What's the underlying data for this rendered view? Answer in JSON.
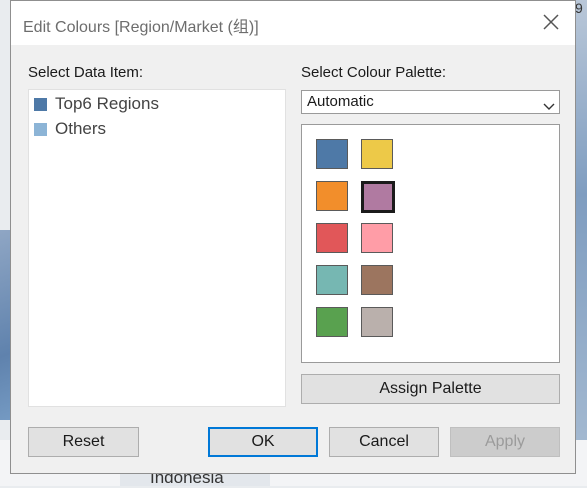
{
  "background": {
    "map_label": "Indonesia",
    "corner_digit": "9"
  },
  "dialog": {
    "title": "Edit Colours [Region/Market (组)]",
    "close_icon": "close-icon"
  },
  "data_items": {
    "label": "Select Data Item:",
    "items": [
      {
        "label": "Top6 Regions",
        "color": "#4e79a7"
      },
      {
        "label": "Others",
        "color": "#8cb4d6"
      }
    ]
  },
  "palette": {
    "label": "Select Colour Palette:",
    "selected": "Automatic",
    "selected_color": "#b07aa1",
    "colors": [
      "#4e79a7",
      "#edc948",
      "#f28e2b",
      "#b07aa1",
      "#e15759",
      "#ff9da7",
      "#76b7b2",
      "#9c755f",
      "#59a14f",
      "#bab0ac"
    ]
  },
  "buttons": {
    "assign_palette": "Assign Palette",
    "reset": "Reset",
    "ok": "OK",
    "cancel": "Cancel",
    "apply": "Apply"
  }
}
